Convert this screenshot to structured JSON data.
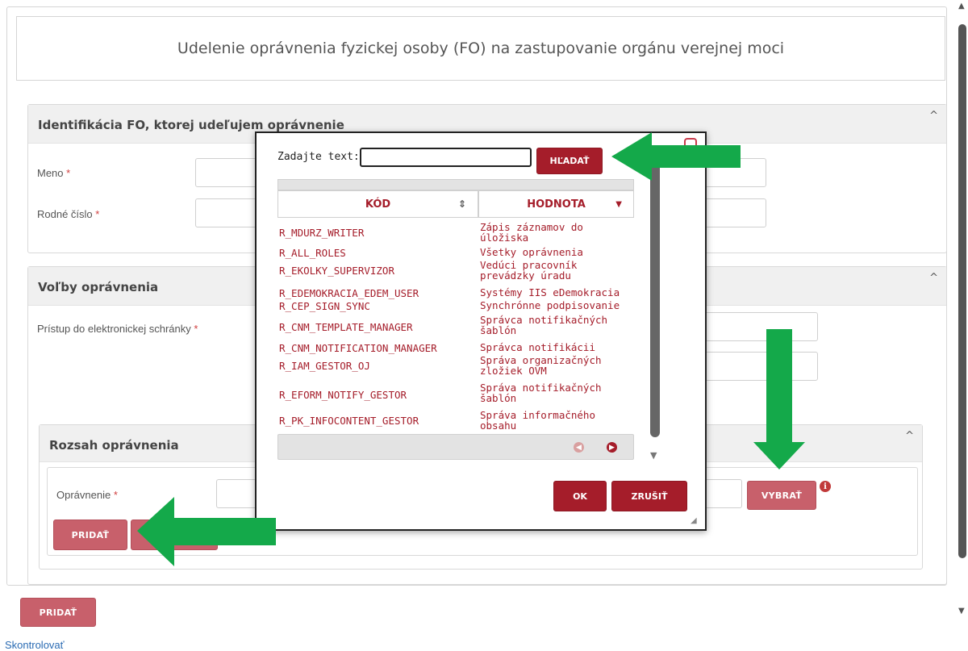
{
  "page": {
    "title": "Udelenie oprávnenia fyzickej osoby (FO) na zastupovanie orgánu verejnej moci"
  },
  "section_identification": {
    "title": "Identifikácia FO, ktorej udeľujem oprávnenie",
    "fields": [
      {
        "label": "Meno",
        "value": ""
      },
      {
        "label": "Rodné číslo",
        "value": ""
      }
    ]
  },
  "section_options": {
    "title": "Voľby oprávnenia",
    "fields": [
      {
        "label": "Prístup do elektronickej schránky",
        "value": ""
      }
    ]
  },
  "section_scope": {
    "title": "Rozsah oprávnenia",
    "permission_label": "Oprávnenie",
    "select_button": "VYBRAŤ",
    "add_button": "PRIDAŤ"
  },
  "bottom": {
    "add_button": "PRIDAŤ",
    "link": "Skontrolovať"
  },
  "required_mark": "*",
  "dialog": {
    "search_label": "Zadajte text:",
    "search_value": "",
    "search_button": "HĽADAŤ",
    "columns": [
      {
        "label": "KÓD",
        "sort": "⇕"
      },
      {
        "label": "HODNOTA",
        "sort": "▼"
      }
    ],
    "rows": [
      {
        "code": "R_MDURZ_WRITER",
        "value": "Zápis záznamov do úložiska"
      },
      {
        "code": "R_ALL_ROLES",
        "value": "Všetky oprávnenia"
      },
      {
        "code": "R_EKOLKY_SUPERVIZOR",
        "value": "Vedúci pracovník prevádzky úradu"
      },
      {
        "code": "R_EDEMOKRACIA_EDEM_USER",
        "value": "Systémy IIS eDemokracia"
      },
      {
        "code": "R_CEP_SIGN_SYNC",
        "value": "Synchrónne podpisovanie"
      },
      {
        "code": "R_CNM_TEMPLATE_MANAGER",
        "value": "Správca notifikačných šablón"
      },
      {
        "code": "R_CNM_NOTIFICATION_MANAGER",
        "value": "Správca notifikácii"
      },
      {
        "code": "R_IAM_GESTOR_OJ",
        "value": "Správa organizačných zložiek OVM"
      },
      {
        "code": "R_EFORM_NOTIFY_GESTOR",
        "value": "Správa notifikačných šablón"
      },
      {
        "code": "R_PK_INFOCONTENT_GESTOR",
        "value": "Správa informačného obsahu"
      }
    ],
    "ok_button": "OK",
    "cancel_button": "ZRUŠIŤ"
  },
  "colors": {
    "accent_dark": "#a51d2a",
    "accent_light": "#c8606b",
    "arrow_green": "#14a94a"
  }
}
